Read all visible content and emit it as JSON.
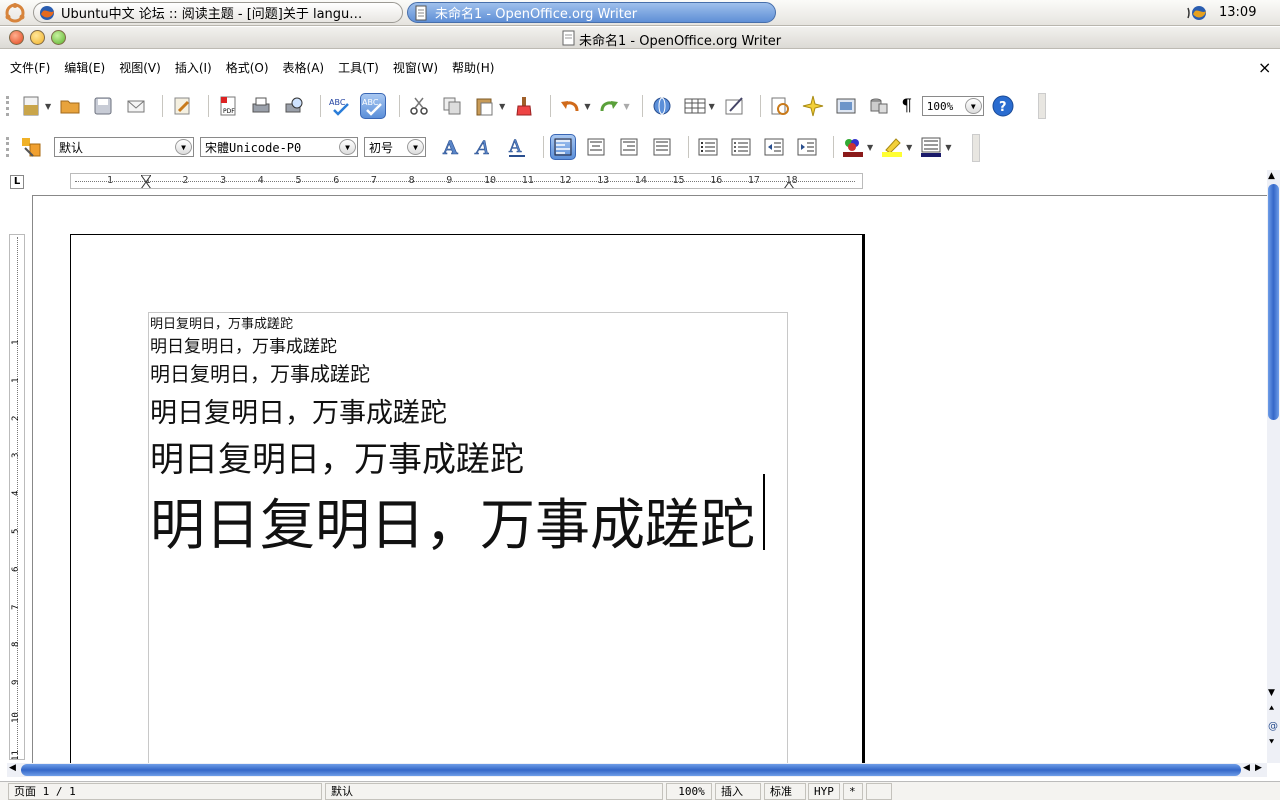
{
  "panel": {
    "tasks": [
      {
        "label": "Ubuntu中文 论坛 :: 阅读主题 - [问题]关于 langu…"
      },
      {
        "label": "未命名1 - OpenOffice.org Writer"
      }
    ],
    "clock": "13:09"
  },
  "window": {
    "title": "未命名1 - OpenOffice.org Writer"
  },
  "menubar": {
    "items": [
      "文件(F)",
      "编辑(E)",
      "视图(V)",
      "插入(I)",
      "格式(O)",
      "表格(A)",
      "工具(T)",
      "视窗(W)",
      "帮助(H)"
    ],
    "close_symbol": "×"
  },
  "toolbar": {
    "paragraph_mark": "¶",
    "zoom_value": "100%"
  },
  "format_bar": {
    "style_value": "默认",
    "font_value": "宋體Unicode-P0",
    "size_value": "初号"
  },
  "ruler": {
    "corner_symbol": "L",
    "h_labels": [
      "1",
      "1",
      "2",
      "3",
      "4",
      "5",
      "6",
      "7",
      "8",
      "9",
      "10",
      "11",
      "12",
      "13",
      "14",
      "15",
      "16",
      "17",
      "18"
    ],
    "v_labels": [
      "1",
      "1",
      "2",
      "3",
      "4",
      "5",
      "6",
      "7",
      "8",
      "9",
      "10",
      "11"
    ]
  },
  "document": {
    "lines": [
      {
        "text": "明日复明日，万事成蹉跎"
      },
      {
        "text": "明日复明日，万事成蹉跎"
      },
      {
        "text": "明日复明日，万事成蹉跎"
      },
      {
        "text": "明日复明日，万事成蹉跎"
      },
      {
        "text": "明日复明日，万事成蹉跎"
      },
      {
        "text": "明日复明日，万事成蹉跎"
      }
    ]
  },
  "statusbar": {
    "page": "页面 1 / 1",
    "style": "默认",
    "zoom": "100%",
    "insert_mode": "插入",
    "selection_mode": "标准",
    "hyphenation": "HYP",
    "modified": "*"
  },
  "colors": {
    "accent": "#3467c8",
    "task_active": "#5f8fd6",
    "help_button": "#2a6cd0"
  }
}
